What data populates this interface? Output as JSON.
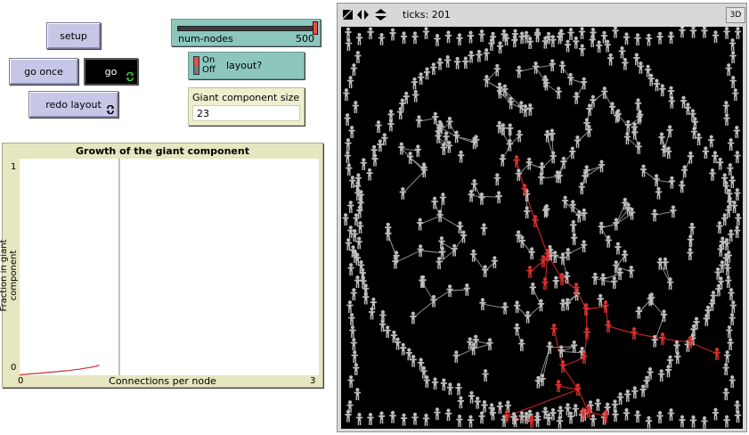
{
  "buttons": {
    "setup": "setup",
    "go_once": "go once",
    "go": "go",
    "redo_layout": "redo layout"
  },
  "slider": {
    "label": "num-nodes",
    "value": "500",
    "min": 0,
    "max": 500,
    "current": 500
  },
  "switch": {
    "on_label": "On",
    "off_label": "Off",
    "label": "layout?",
    "state": "on"
  },
  "monitor": {
    "label": "Giant component size",
    "value": "23"
  },
  "plot": {
    "title": "Growth of the giant component",
    "xlabel": "Connections per node",
    "ylabel": "Fraction in giant component",
    "x_min_label": "0",
    "x_max_label": "3",
    "y_min_label": "0",
    "y_max_label": "1"
  },
  "chart_data": {
    "type": "line",
    "title": "Growth of the giant component",
    "xlabel": "Connections per node",
    "ylabel": "Fraction in giant component",
    "xlim": [
      0,
      3
    ],
    "ylim": [
      0,
      1
    ],
    "vline_x": 1,
    "series": [
      {
        "color": "#d03030",
        "x": [
          0,
          0.05,
          0.1,
          0.15,
          0.2,
          0.25,
          0.3,
          0.35,
          0.4,
          0.45,
          0.5,
          0.55,
          0.6,
          0.65,
          0.7,
          0.75,
          0.8
        ],
        "y": [
          0.002,
          0.004,
          0.006,
          0.008,
          0.01,
          0.012,
          0.014,
          0.016,
          0.018,
          0.02,
          0.022,
          0.026,
          0.028,
          0.032,
          0.036,
          0.04,
          0.046
        ]
      }
    ]
  },
  "view": {
    "ticks_label": "ticks: 201",
    "button_3d": "3D"
  },
  "colors": {
    "button": "#c6c6e6",
    "slider": "#8dc6bd",
    "monitor": "#efefcf",
    "plot": "#e6e6c0",
    "node": "#bdbdbd",
    "giant": "#e03030"
  }
}
